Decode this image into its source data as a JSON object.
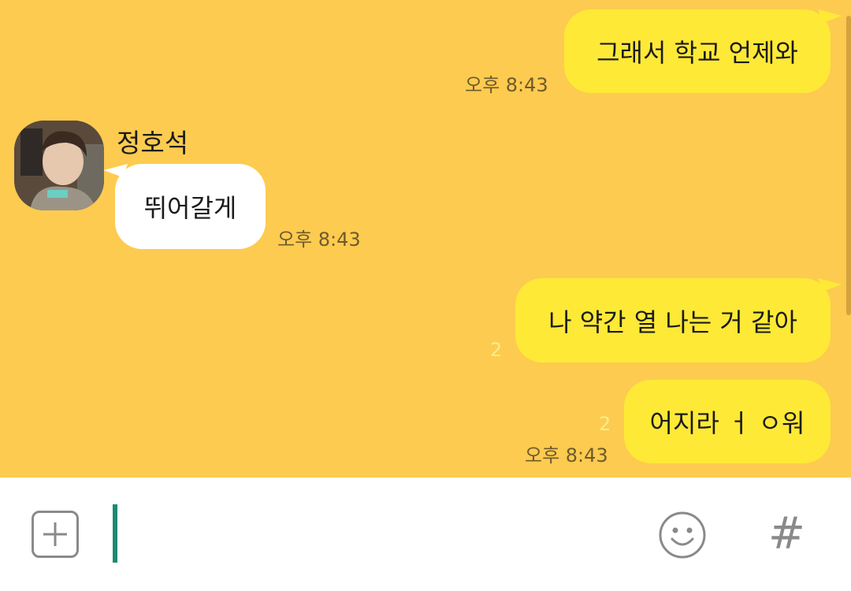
{
  "colors": {
    "background": "#FDCB4F",
    "my_bubble": "#FEE937",
    "other_bubble": "#FFFFFF",
    "input_bar": "#FFFFFF",
    "cursor": "#1A8A72"
  },
  "messages": [
    {
      "from": "me",
      "text": "그래서 학교 언제와",
      "time": "오후 8:43",
      "unread": ""
    },
    {
      "from": "other",
      "sender": "정호석",
      "text": "뛰어갈게",
      "time": "오후 8:43"
    },
    {
      "from": "me",
      "text": "나 약간 열 나는 거 같아",
      "time": "",
      "unread": "2"
    },
    {
      "from": "me",
      "text": "어지라 ㅓ ㅇ워",
      "time": "오후 8:43",
      "unread": "2"
    }
  ],
  "input": {
    "value": "",
    "placeholder": ""
  },
  "icons": {
    "attach": "plus-square-icon",
    "emoji": "smiley-face-icon",
    "hashtag": "hashtag-icon"
  },
  "hashtag_glyph": "#"
}
